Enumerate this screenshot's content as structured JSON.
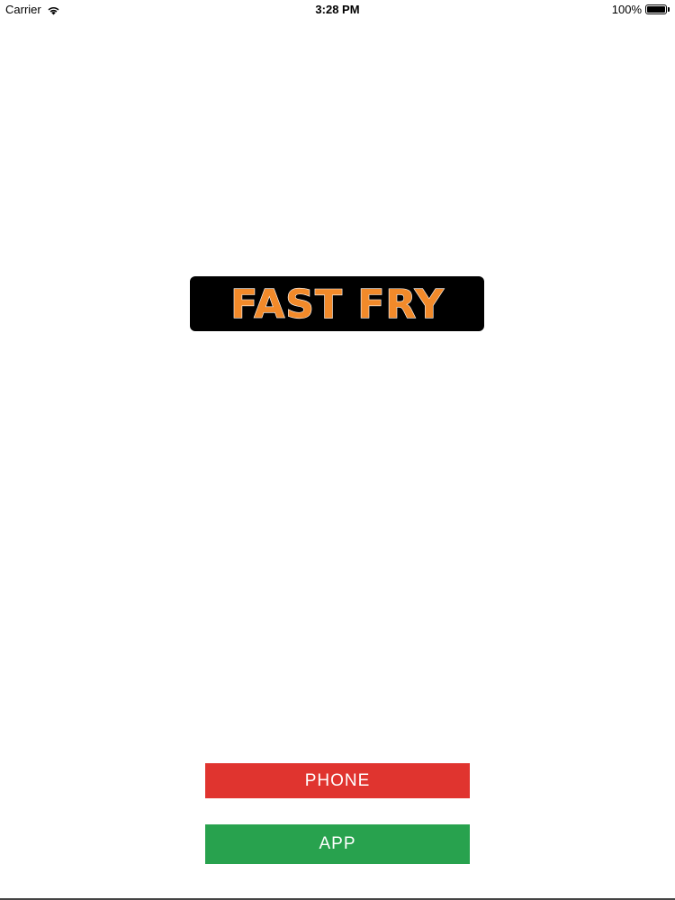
{
  "status_bar": {
    "carrier": "Carrier",
    "wifi_icon": "wifi-icon",
    "time": "3:28 PM",
    "battery_percent": "100%",
    "battery_icon": "battery-icon",
    "battery_level": 1.0
  },
  "logo": {
    "text": "FAST FRY",
    "background_color": "#000000",
    "text_color": "#f28a2a"
  },
  "buttons": {
    "phone": {
      "label": "PHONE",
      "color": "#e0342f"
    },
    "app": {
      "label": "APP",
      "color": "#28a24e"
    }
  }
}
